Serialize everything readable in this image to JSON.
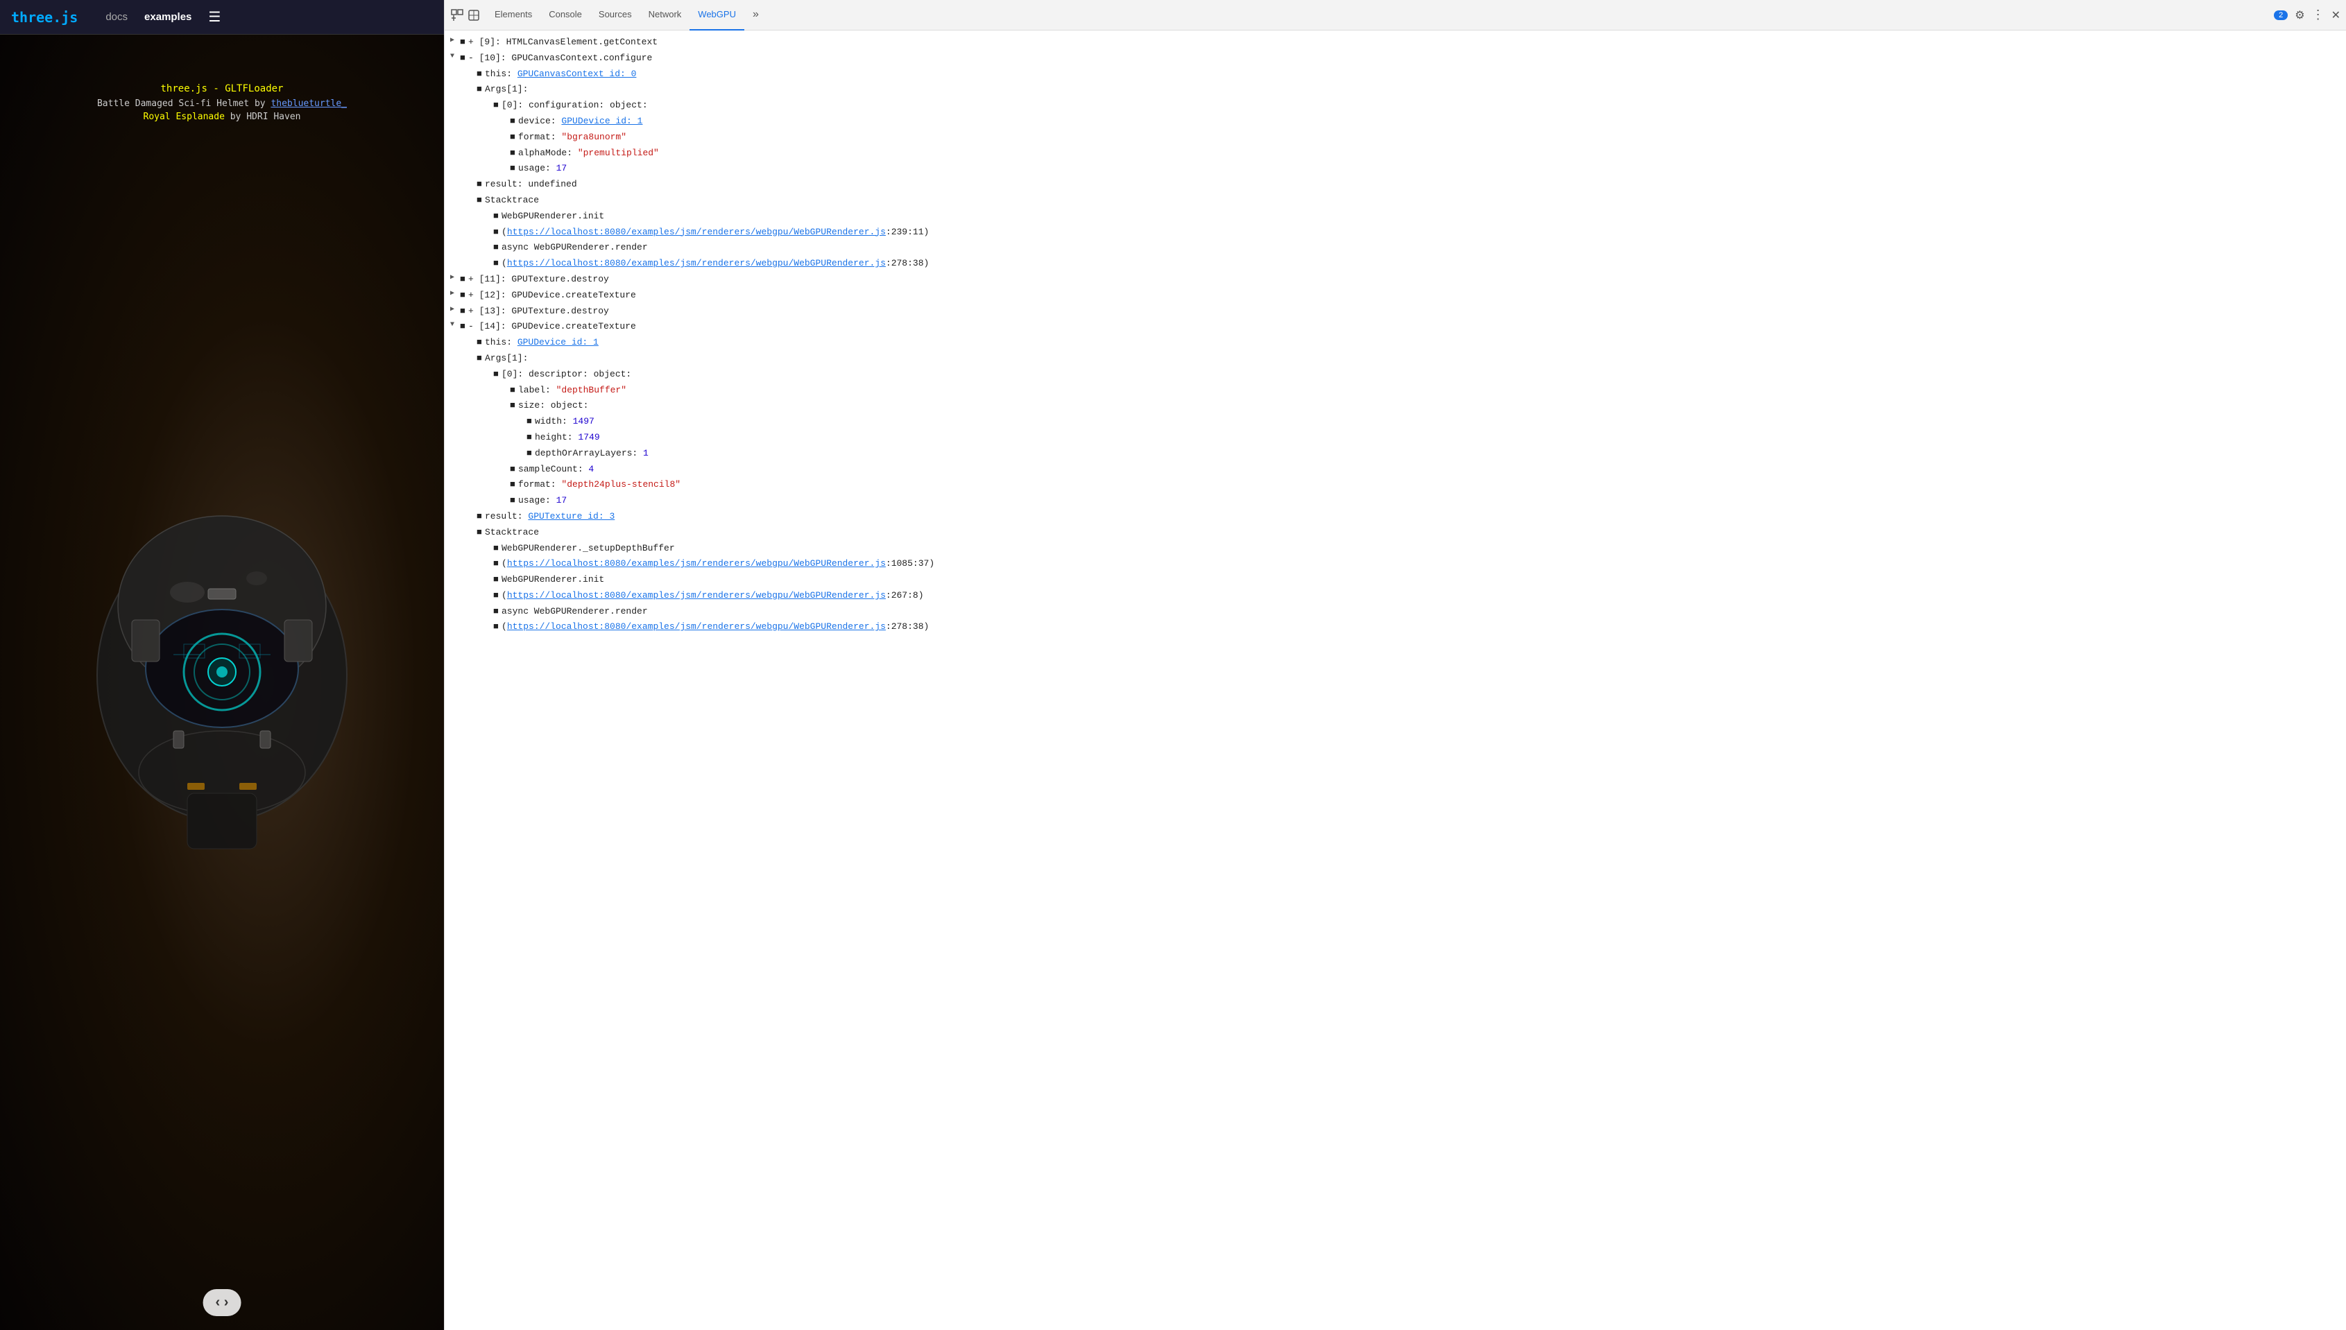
{
  "topnav": {
    "title": "three.js",
    "docs": "docs",
    "examples": "examples",
    "menu_icon": "☰"
  },
  "demo": {
    "title": "three.js - GLTFLoader",
    "subtitle_prefix": "Battle Damaged Sci-fi Helmet by ",
    "subtitle_link": "theblueturtle_",
    "subtitle2_prefix": "Royal Esplanade",
    "subtitle2_middle": " by ",
    "subtitle2_suffix": "HDRI Haven",
    "nav_arrows": "‹ ›"
  },
  "devtools": {
    "tabs": [
      {
        "label": "Elements",
        "active": false
      },
      {
        "label": "Console",
        "active": false
      },
      {
        "label": "Sources",
        "active": false
      },
      {
        "label": "Network",
        "active": false
      },
      {
        "label": "WebGPU",
        "active": true
      }
    ],
    "badge_count": "2",
    "more_tabs": "»",
    "settings_icon": "⚙",
    "more_options_icon": "⋮",
    "close_icon": "✕"
  },
  "content": {
    "items": [
      {
        "indent": 0,
        "bullet": "■",
        "expand": "+",
        "text": "[9]: HTMLCanvasElement.getContext",
        "type": "plain"
      },
      {
        "indent": 0,
        "bullet": "■",
        "expand": "-",
        "text": "[10]: GPUCanvasContext.configure",
        "type": "plain"
      },
      {
        "indent": 1,
        "bullet": "■",
        "expand": "",
        "text": "this: ",
        "link": "GPUCanvasContext id: 0",
        "after": "",
        "type": "link"
      },
      {
        "indent": 1,
        "bullet": "■",
        "expand": "",
        "text": "Args[1]:",
        "type": "plain"
      },
      {
        "indent": 2,
        "bullet": "■",
        "expand": "",
        "text": "[0]: configuration: object:",
        "type": "plain"
      },
      {
        "indent": 3,
        "bullet": "■",
        "expand": "",
        "text": "device: ",
        "link": "GPUDevice id: 1",
        "type": "link"
      },
      {
        "indent": 3,
        "bullet": "■",
        "expand": "",
        "text": "format: ",
        "string": "\"bgra8unorm\"",
        "type": "string"
      },
      {
        "indent": 3,
        "bullet": "■",
        "expand": "",
        "text": "alphaMode: ",
        "string": "\"premultiplied\"",
        "type": "string"
      },
      {
        "indent": 3,
        "bullet": "■",
        "expand": "",
        "text": "usage: ",
        "number": "17",
        "type": "number"
      },
      {
        "indent": 1,
        "bullet": "■",
        "expand": "",
        "text": "result: undefined",
        "type": "plain"
      },
      {
        "indent": 1,
        "bullet": "■",
        "expand": "",
        "text": "Stacktrace",
        "type": "plain"
      },
      {
        "indent": 2,
        "bullet": "■",
        "expand": "",
        "text": "WebGPURenderer.init",
        "type": "plain"
      },
      {
        "indent": 2,
        "bullet": "■",
        "expand": "",
        "link_only": "https://localhost:8080/examples/jsm/renderers/webgpu/WebGPURenderer.js",
        "after": ":239:11)",
        "prefix": "(",
        "type": "stacklink"
      },
      {
        "indent": 2,
        "bullet": "■",
        "expand": "",
        "text": "async WebGPURenderer.render",
        "type": "plain"
      },
      {
        "indent": 2,
        "bullet": "■",
        "expand": "",
        "link_only": "https://localhost:8080/examples/jsm/renderers/webgpu/WebGPURenderer.js",
        "after": ":278:38)",
        "prefix": "(",
        "type": "stacklink"
      },
      {
        "indent": 0,
        "bullet": "■",
        "expand": "+",
        "text": "[11]: GPUTexture.destroy",
        "type": "plain"
      },
      {
        "indent": 0,
        "bullet": "■",
        "expand": "+",
        "text": "[12]: GPUDevice.createTexture",
        "type": "plain"
      },
      {
        "indent": 0,
        "bullet": "■",
        "expand": "+",
        "text": "[13]: GPUTexture.destroy",
        "type": "plain"
      },
      {
        "indent": 0,
        "bullet": "■",
        "expand": "-",
        "text": "[14]: GPUDevice.createTexture",
        "type": "plain"
      },
      {
        "indent": 1,
        "bullet": "■",
        "expand": "",
        "text": "this: ",
        "link": "GPUDevice id: 1",
        "type": "link"
      },
      {
        "indent": 1,
        "bullet": "■",
        "expand": "",
        "text": "Args[1]:",
        "type": "plain"
      },
      {
        "indent": 2,
        "bullet": "■",
        "expand": "",
        "text": "[0]: descriptor: object:",
        "type": "plain"
      },
      {
        "indent": 3,
        "bullet": "■",
        "expand": "",
        "text": "label: ",
        "string": "\"depthBuffer\"",
        "type": "string"
      },
      {
        "indent": 3,
        "bullet": "■",
        "expand": "",
        "text": "size: object:",
        "type": "plain"
      },
      {
        "indent": 4,
        "bullet": "■",
        "expand": "",
        "text": "width: ",
        "number": "1497",
        "type": "number"
      },
      {
        "indent": 4,
        "bullet": "■",
        "expand": "",
        "text": "height: ",
        "number": "1749",
        "type": "number"
      },
      {
        "indent": 4,
        "bullet": "■",
        "expand": "",
        "text": "depthOrArrayLayers: ",
        "number": "1",
        "type": "number"
      },
      {
        "indent": 3,
        "bullet": "■",
        "expand": "",
        "text": "sampleCount: ",
        "number": "4",
        "type": "number"
      },
      {
        "indent": 3,
        "bullet": "■",
        "expand": "",
        "text": "format: ",
        "string": "\"depth24plus-stencil8\"",
        "type": "string"
      },
      {
        "indent": 3,
        "bullet": "■",
        "expand": "",
        "text": "usage: ",
        "number": "17",
        "type": "number"
      },
      {
        "indent": 1,
        "bullet": "■",
        "expand": "",
        "text": "result: ",
        "link": "GPUTexture id: 3",
        "type": "link"
      },
      {
        "indent": 1,
        "bullet": "■",
        "expand": "",
        "text": "Stacktrace",
        "type": "plain"
      },
      {
        "indent": 2,
        "bullet": "■",
        "expand": "",
        "text": "WebGPURenderer._setupDepthBuffer",
        "type": "plain"
      },
      {
        "indent": 2,
        "bullet": "■",
        "expand": "",
        "link_only": "https://localhost:8080/examples/jsm/renderers/webgpu/WebGPURenderer.js",
        "after": ":1085:37)",
        "prefix": "(",
        "type": "stacklink"
      },
      {
        "indent": 2,
        "bullet": "■",
        "expand": "",
        "text": "WebGPURenderer.init",
        "type": "plain"
      },
      {
        "indent": 2,
        "bullet": "■",
        "expand": "",
        "link_only": "https://localhost:8080/examples/jsm/renderers/webgpu/WebGPURenderer.js",
        "after": ":267:8)",
        "prefix": "(",
        "type": "stacklink"
      },
      {
        "indent": 2,
        "bullet": "■",
        "expand": "",
        "text": "async WebGPURenderer.render",
        "type": "plain"
      },
      {
        "indent": 2,
        "bullet": "■",
        "expand": "",
        "link_only": "https://localhost:8080/examples/jsm/renderers/webgpu/WebGPURenderer.js",
        "after": ":278:38)",
        "prefix": "(",
        "type": "stacklink"
      }
    ]
  }
}
